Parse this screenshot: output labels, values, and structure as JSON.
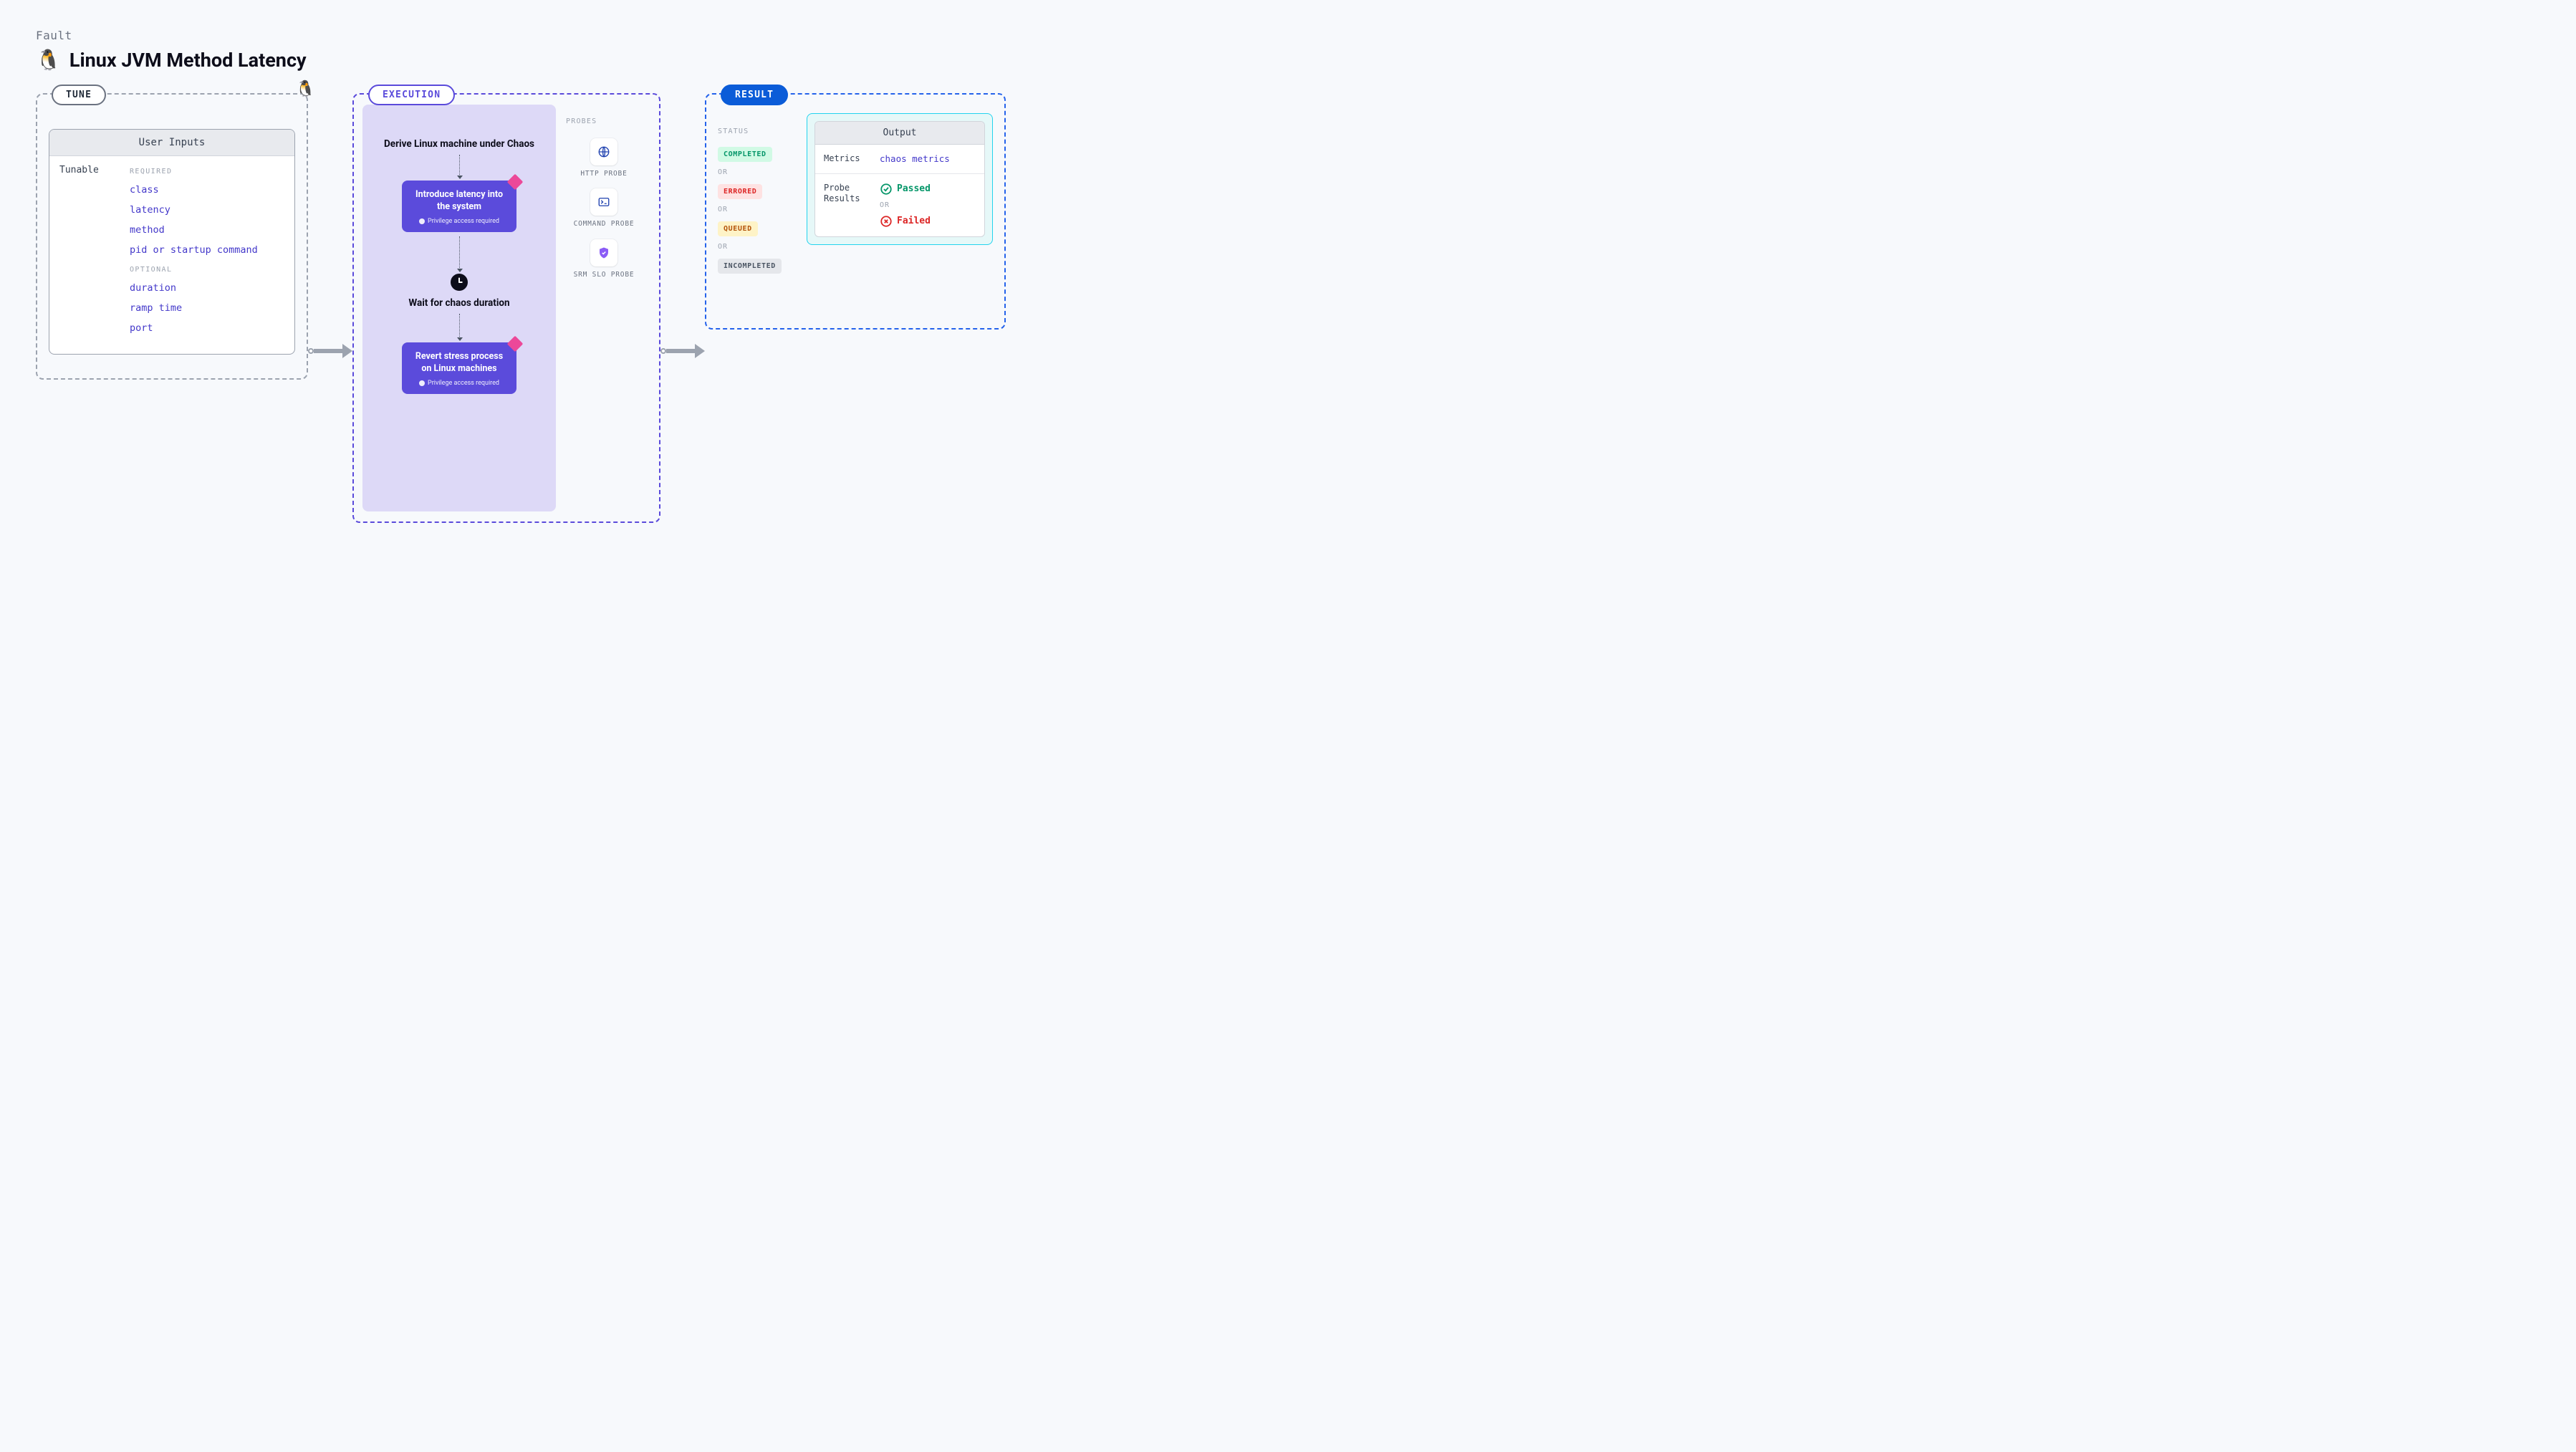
{
  "header": {
    "category": "Fault",
    "title": "Linux JVM Method Latency"
  },
  "tune": {
    "badge": "TUNE",
    "card_title": "User Inputs",
    "left_label": "Tunable",
    "required_label": "REQUIRED",
    "optional_label": "OPTIONAL",
    "required": [
      "class",
      "latency",
      "method",
      "pid or startup command"
    ],
    "optional": [
      "duration",
      "ramp time",
      "port"
    ]
  },
  "execution": {
    "badge": "EXECUTION",
    "step1": "Derive Linux machine under Chaos",
    "action1_title": "Introduce latency into the system",
    "action_privilege": "Privilege access required",
    "wait_label": "Wait for chaos duration",
    "action2_title": "Revert stress process on Linux machines",
    "probes_label": "PROBES",
    "probes": [
      {
        "id": "http",
        "label": "HTTP PROBE"
      },
      {
        "id": "command",
        "label": "COMMAND PROBE"
      },
      {
        "id": "srm",
        "label": "SRM SLO PROBE"
      }
    ]
  },
  "result": {
    "badge": "RESULT",
    "status_label": "STATUS",
    "or": "OR",
    "statuses": {
      "completed": "COMPLETED",
      "errored": "ERRORED",
      "queued": "QUEUED",
      "incompleted": "INCOMPLETED"
    },
    "output_title": "Output",
    "metrics_key": "Metrics",
    "metrics_val": "chaos metrics",
    "probe_results_key": "Probe Results",
    "passed": "Passed",
    "failed": "Failed"
  }
}
